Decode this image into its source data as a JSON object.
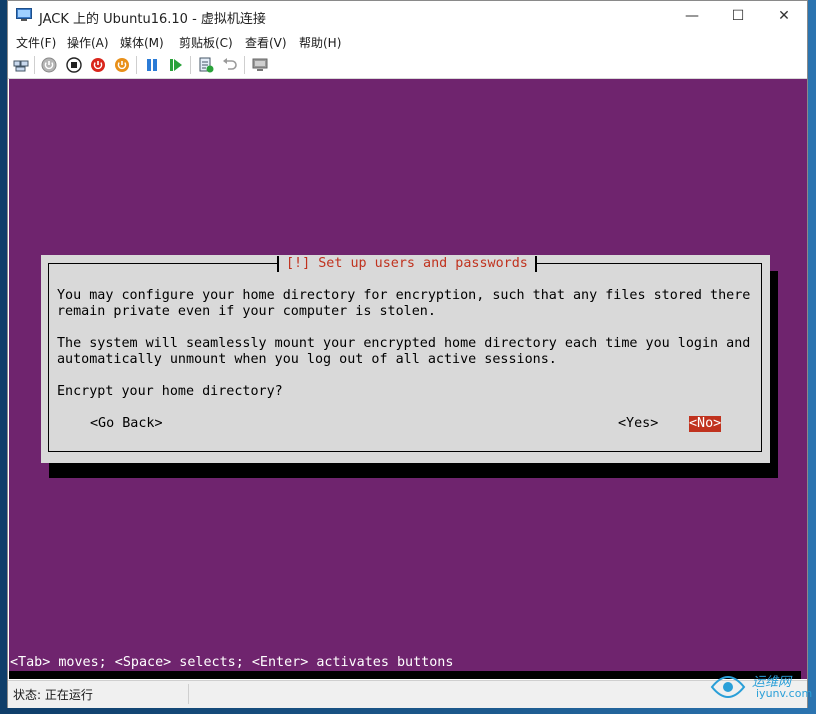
{
  "window": {
    "title": "JACK 上的 Ubuntu16.10 - 虚拟机连接",
    "controls": {
      "minimize": "—",
      "maximize": "☐",
      "close": "✕"
    }
  },
  "menu": [
    "文件(F)",
    "操作(A)",
    "媒体(M)",
    "剪贴板(C)",
    "查看(V)",
    "帮助(H)"
  ],
  "toolbar": {
    "icons": [
      "ctrl-alt-del-icon",
      "start-icon",
      "turn-off-icon",
      "shutdown-icon",
      "save-icon",
      "pause-icon",
      "reset-icon",
      "checkpoint-icon",
      "revert-icon",
      "enhanced-session-icon"
    ]
  },
  "installer": {
    "dialog_title": "[!] Set up users and passwords",
    "paragraph1_line1": "You may configure your home directory for encryption, such that any files stored there",
    "paragraph1_line2": "remain private even if your computer is stolen.",
    "paragraph2_line1": "The system will seamlessly mount your encrypted home directory each time you login and",
    "paragraph2_line2": "automatically unmount when you log out of all active sessions.",
    "question": "Encrypt your home directory?",
    "buttons": {
      "back": "<Go Back>",
      "yes": "<Yes>",
      "no": "<No>"
    },
    "selected_button": "no",
    "help_line": "<Tab> moves; <Space> selects; <Enter> activates buttons",
    "colors": {
      "background": "#6f246e",
      "dialog": "#d9d9d9",
      "accent": "#c0321e"
    }
  },
  "status": {
    "label": "状态: 正在运行"
  },
  "watermark": {
    "text": "运维网",
    "sub": "iyunv.com"
  }
}
